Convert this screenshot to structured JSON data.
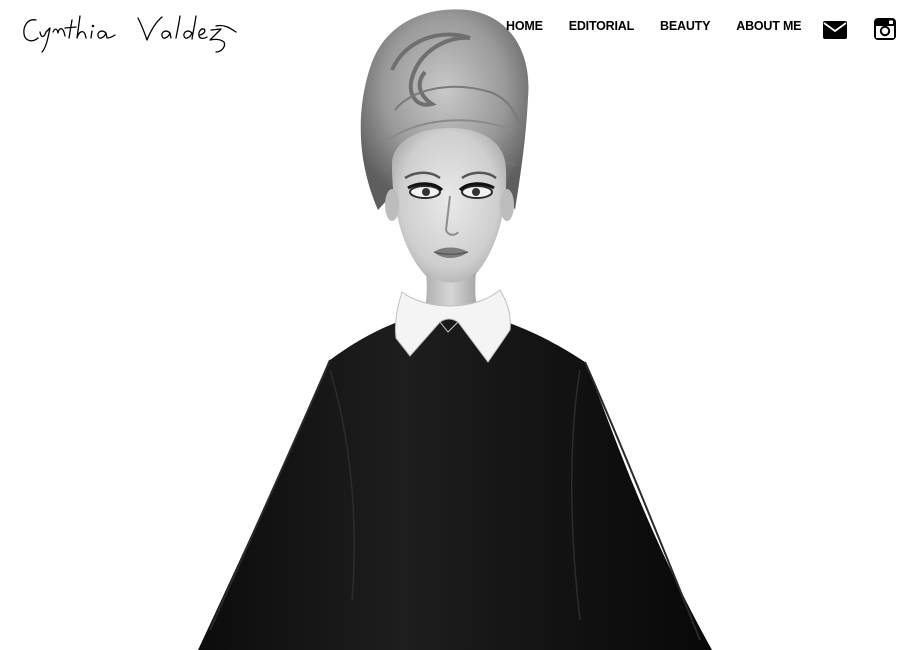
{
  "site": {
    "logo_text": "Cynthia Valdez"
  },
  "nav": {
    "items": [
      {
        "label": "HOME"
      },
      {
        "label": "EDITORIAL"
      },
      {
        "label": "BEAUTY"
      },
      {
        "label": "ABOUT ME"
      }
    ]
  },
  "social": {
    "icons": [
      "envelope-icon",
      "instagram-icon"
    ]
  },
  "hero": {
    "image": "black-and-white portrait photo"
  },
  "colors": {
    "background": "#ffffff",
    "text": "#000000"
  }
}
